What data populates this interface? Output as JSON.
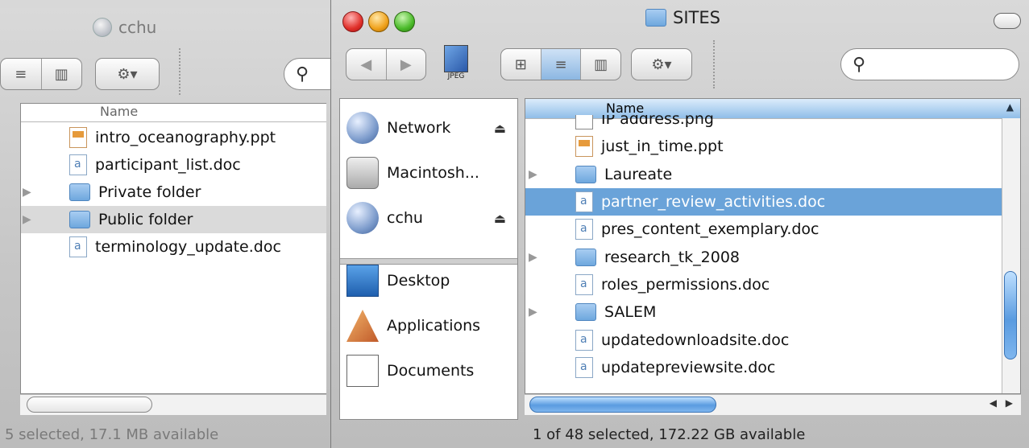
{
  "back_window": {
    "title": "cchu",
    "name_header": "Name",
    "files": [
      {
        "name": "intro_oceanography.ppt",
        "type": "ppt"
      },
      {
        "name": "participant_list.doc",
        "type": "doc"
      },
      {
        "name": "Private folder",
        "type": "folder"
      },
      {
        "name": "Public folder",
        "type": "folder"
      },
      {
        "name": "terminology_update.doc",
        "type": "doc"
      }
    ],
    "status": "5 selected, 17.1 MB available"
  },
  "front_window": {
    "title": "SITES",
    "jpeg_label": "JPEG",
    "name_header": "Name",
    "sidebar": {
      "devices": [
        {
          "label": "Network",
          "eject": true
        },
        {
          "label": "Macintosh...",
          "eject": false
        },
        {
          "label": "cchu",
          "eject": true
        }
      ],
      "places": [
        {
          "label": "Desktop"
        },
        {
          "label": "Applications"
        },
        {
          "label": "Documents"
        }
      ]
    },
    "files": [
      {
        "name": "IP address.png",
        "type": "png"
      },
      {
        "name": "just_in_time.ppt",
        "type": "ppt"
      },
      {
        "name": "Laureate",
        "type": "folder"
      },
      {
        "name": "partner_review_activities.doc",
        "type": "doc",
        "selected": true
      },
      {
        "name": "pres_content_exemplary.doc",
        "type": "doc"
      },
      {
        "name": "research_tk_2008",
        "type": "folder"
      },
      {
        "name": "roles_permissions.doc",
        "type": "doc"
      },
      {
        "name": "SALEM",
        "type": "folder"
      },
      {
        "name": "updatedownloadsite.doc",
        "type": "doc"
      },
      {
        "name": "updatepreviewsite.doc",
        "type": "doc"
      }
    ],
    "status": "1 of 48 selected, 172.22 GB available"
  },
  "icons": {
    "back": "left-arrow",
    "forward": "right-arrow",
    "view_icon": "grid-icon",
    "view_list": "list-icon",
    "view_column": "column-icon",
    "action": "gear-icon",
    "search": "magnifier-icon",
    "eject": "eject-icon"
  },
  "colors": {
    "selection": "#6aa3d9",
    "accent_blue": "#5a9be0"
  }
}
